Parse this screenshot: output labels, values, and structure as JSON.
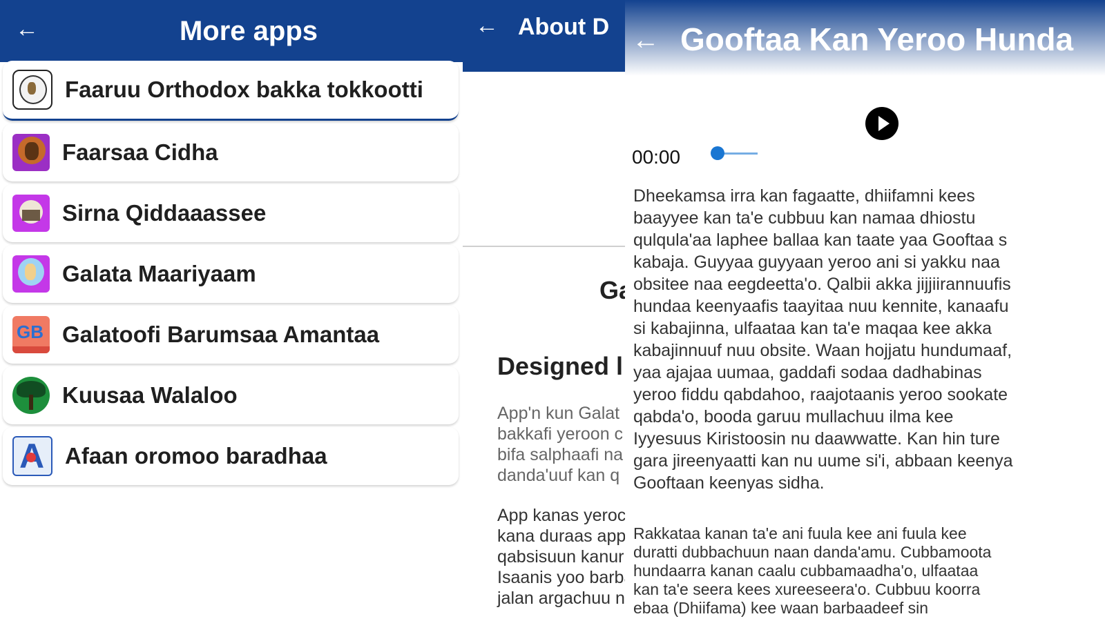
{
  "panel1": {
    "title": "More apps",
    "apps": [
      {
        "label": "Faaruu Orthodox bakka tokkootti",
        "icon": "orthodox-emblem-icon"
      },
      {
        "label": "Faarsaa Cidha",
        "icon": "icon-orange-purple"
      },
      {
        "label": "Sirna Qiddaaassee",
        "icon": "church-purple-icon"
      },
      {
        "label": "Galata Maariyaam",
        "icon": "mary-icon"
      },
      {
        "label": "Galatoofi Barumsaa Amantaa",
        "icon": "gb-logo-icon"
      },
      {
        "label": "Kuusaa Walaloo",
        "icon": "tree-globe-icon"
      },
      {
        "label": "Afaan oromoo baradhaa",
        "icon": "a-logo-icon"
      }
    ]
  },
  "panel2": {
    "title": "About D",
    "ga": "Ga",
    "designed": "Designed l",
    "para1": [
      "App'n kun Galat",
      "bakkafi yeroon c",
      "bifa salphaafi na",
      "danda'uuf kan q"
    ],
    "para1_bold": "Galat",
    "para2": [
      "App kanas yeroc",
      "kana duraas app",
      "qabsisuun kanur",
      "Isaanis yoo barba",
      "jalan argachuu ni"
    ]
  },
  "panel3": {
    "title": "Gooftaa Kan Yeroo Hunda",
    "time": "00:00",
    "lyrics1": [
      "Dheekamsa irra kan fagaatte, dhiifamni kees",
      "baayyee kan ta'e cubbuu kan namaa dhiostu",
      "qulqula'aa laphee ballaa kan taate yaa Gooftaa s",
      "kabaja. Guyyaa guyyaan yeroo ani si yakku naa",
      "obsitee naa eegdeetta'o. Qalbii akka jijjiirannuufis",
      "hundaa keenyaafis taayitaa nuu kennite, kanaafu",
      "si kabajinna, ulfaataa kan ta'e maqaa kee akka",
      "kabajinnuuf nuu obsite. Waan hojjatu hundumaaf,",
      "yaa ajajaa uumaa, gaddafi sodaa dadhabinas",
      "yeroo fiddu qabdahoo, raajotaanis yeroo sookate",
      "qabda'o, booda garuu mullachuu ilma kee",
      "Iyyesuus Kiristoosin nu daawwatte. Kan hin ture",
      "gara jireenyaatti kan nu uume si'i, abbaan keenya",
      "Gooftaan keenyas sidha."
    ],
    "lyrics2": [
      "Rakkataa kanan ta'e ani fuula kee ani fuula kee",
      "duratti dubbachuun naan danda'amu. Cubbamoota",
      "hundaarra kanan caalu cubbamaadha'o, ulfaataa",
      "kan ta'e seera kees xureeseera'o. Cubbuu koorra",
      "ebaa (Dhiifama) kee waan barbaadeef sin"
    ]
  },
  "colors": {
    "header_blue": "#13428f",
    "seek_blue": "#1976d2"
  }
}
